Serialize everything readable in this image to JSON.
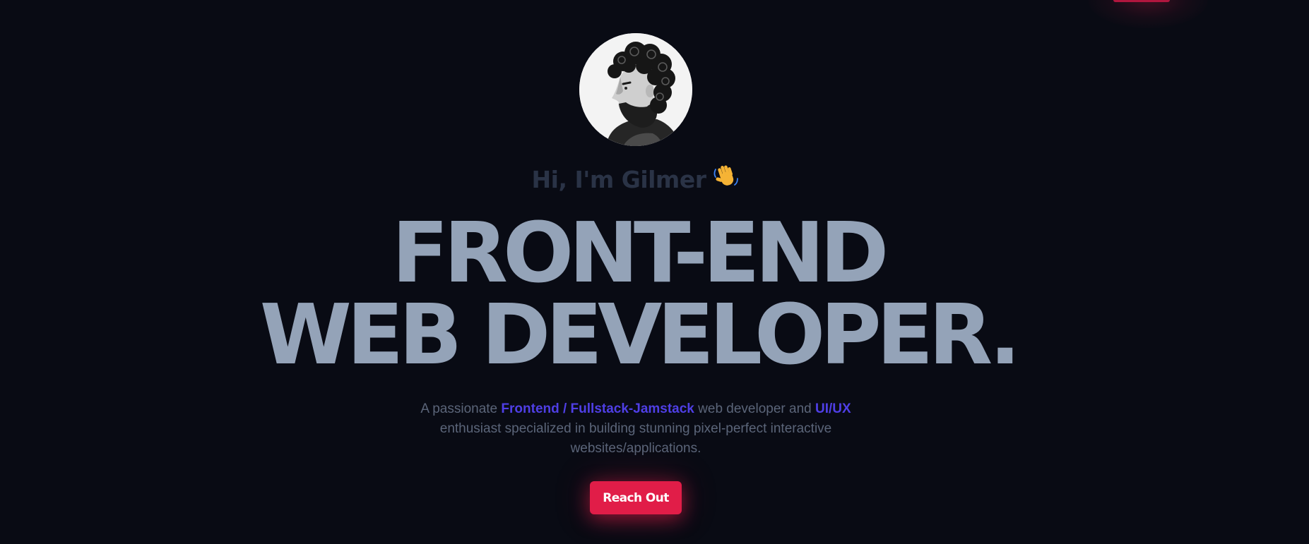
{
  "colors": {
    "background": "#090b14",
    "headline": "#94a3b8",
    "greeting": "#2a3346",
    "body_text": "#5b6579",
    "highlight": "#4f3fe6",
    "accent": "#e11d48"
  },
  "hero": {
    "avatar_icon": "portrait-photo",
    "greeting": "Hi, I'm Gilmer",
    "greeting_emoji": "👋",
    "headline_line1": "FRONT-END",
    "headline_line2": "WEB DEVELOPER.",
    "description": {
      "part1": "A passionate ",
      "highlight1": "Frontend / Fullstack-Jamstack",
      "part2": " web developer and ",
      "highlight2": "UI/UX",
      "part3": " enthusiast specialized in building stunning pixel-perfect interactive websites/applications."
    },
    "cta_label": "Reach Out"
  }
}
